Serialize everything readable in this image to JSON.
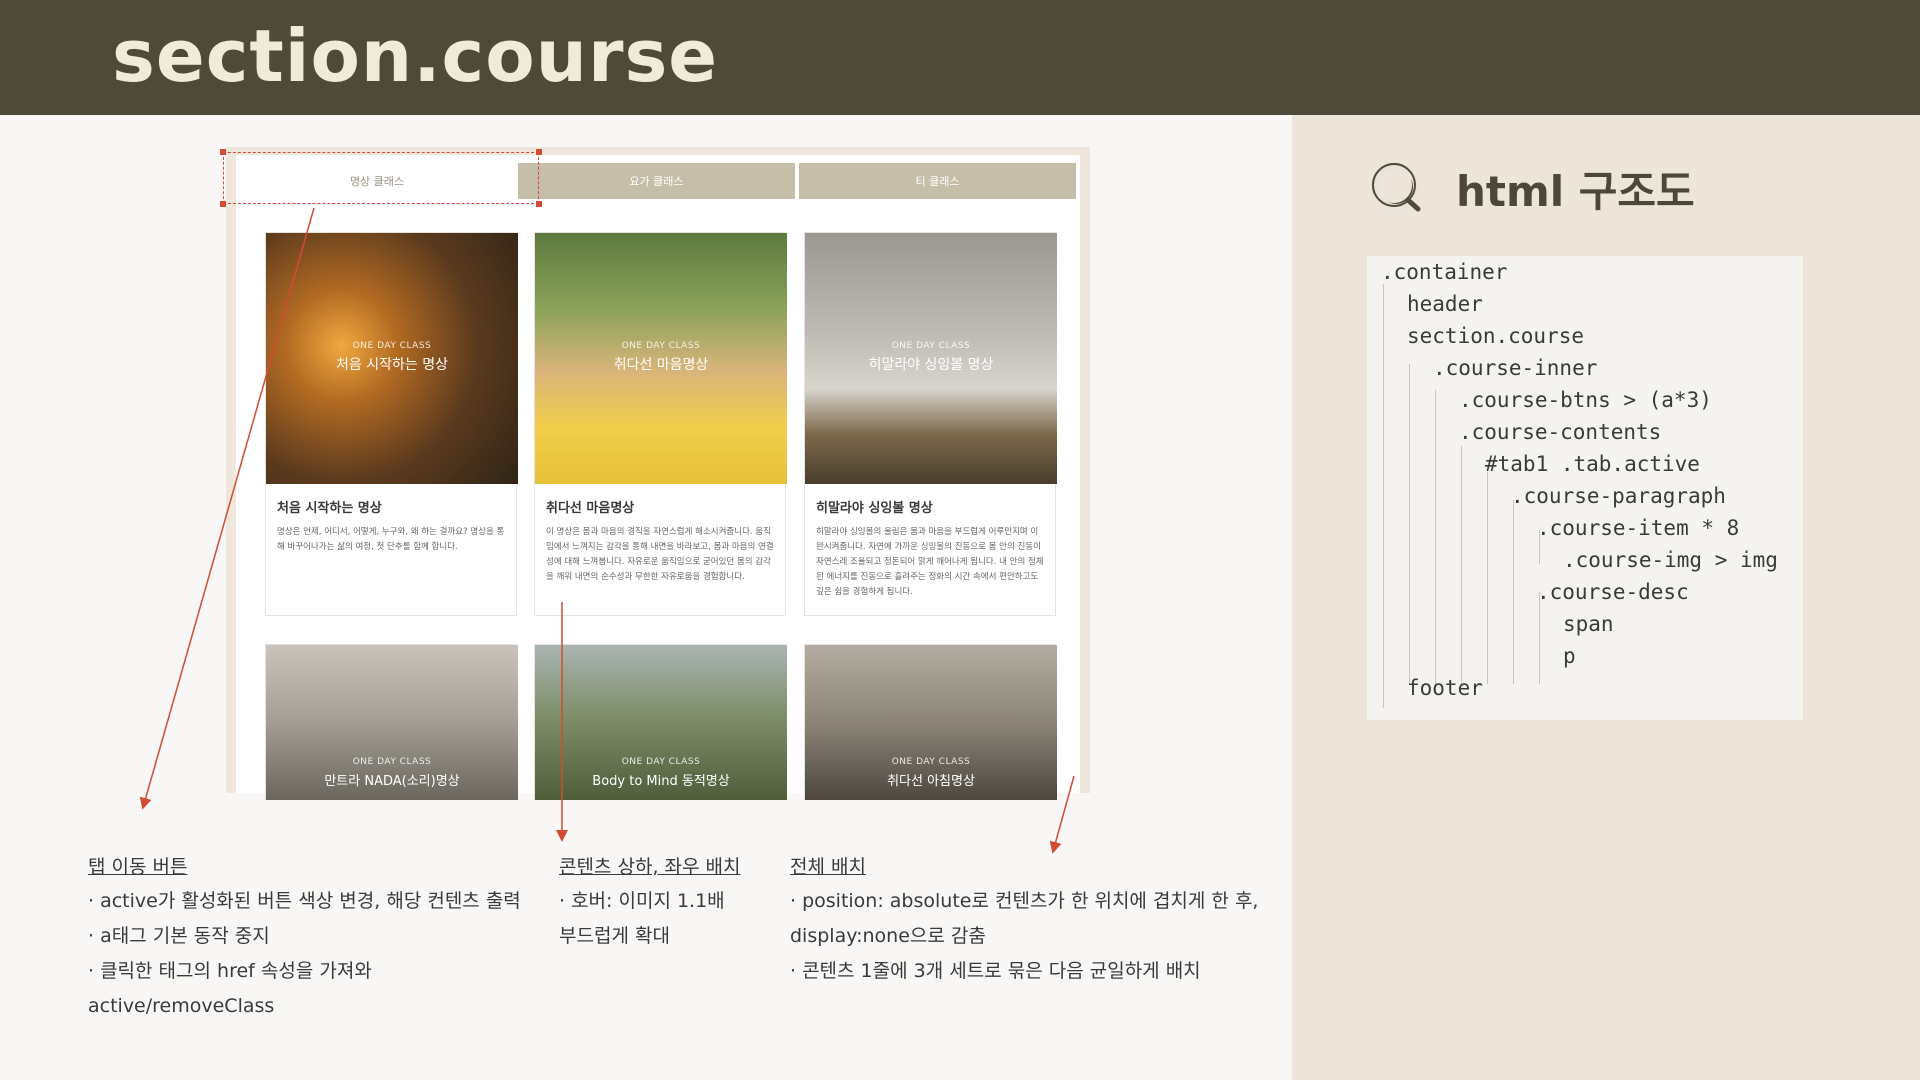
{
  "header": {
    "title": "section.course"
  },
  "side": {
    "title": "html 구조도",
    "tree": [
      ".container",
      "header",
      "section.course",
      ".course-inner",
      ".course-btns > (a*3)",
      ".course-contents",
      "#tab1 .tab.active",
      ".course-paragraph",
      ".course-item * 8",
      ".course-img > img",
      ".course-desc",
      "span",
      "p",
      "footer"
    ]
  },
  "mock": {
    "tabs": [
      "명상 클래스",
      "요가 클래스",
      "티 클래스"
    ],
    "cards": [
      {
        "kicker": "ONE DAY CLASS",
        "overlay": "처음 시작하는 명상",
        "title": "처음 시작하는 명상",
        "desc": "명상은 언제, 어디서, 어떻게, 누구와, 왜 하는 걸까요? 명상을 통해 바꾸어나가는 삶의 여정, 첫 단추를 함께 합니다."
      },
      {
        "kicker": "ONE DAY CLASS",
        "overlay": "취다선 마음명상",
        "title": "취다선 마음명상",
        "desc": "이 명상은 몸과 마음의 경직을 자연스럽게 해소시켜줍니다. 움직임에서 느껴지는 감각을 통해 내면을 바라보고, 몸과 마음의 연결성에 대해 느껴봅니다. 자유로운 움직임으로 굳어있던 몸의 감각을 깨워 내면의 순수성과 무한한 자유로움을 경험합니다."
      },
      {
        "kicker": "ONE DAY CLASS",
        "overlay": "히말라야 싱잉볼 명상",
        "title": "히말라야 싱잉볼 명상",
        "desc": "히말라야 싱잉볼의 울림은 몸과 마음을 부드럽게 어루만지며 이완시켜줍니다. 자연에 가까운 싱잉볼의 진동으로 몸 안의 진동이 자연스레 조율되고 정돈되어 맑게 깨어나게 됩니다. 내 안의 정체된 에너지를 진동으로 흘려주는 정화의 시간 속에서 편안하고도 깊은 쉼을 경험하게 됩니다."
      },
      {
        "kicker": "ONE DAY CLASS",
        "overlay": "만트라 NADA(소리)명상"
      },
      {
        "kicker": "ONE DAY CLASS",
        "overlay": "Body to Mind 동적명상"
      },
      {
        "kicker": "ONE DAY CLASS",
        "overlay": "취다선 아침명상"
      }
    ]
  },
  "notes": {
    "tab": {
      "heading": "탭 이동 버튼",
      "lines": [
        "· active가 활성화된 버튼 색상 변경, 해당 컨텐츠 출력",
        "· a태그 기본 동작 중지",
        "· 클릭한 태그의 href 속성을 가져와",
        "active/removeClass"
      ]
    },
    "content": {
      "heading": "콘텐츠 상하, 좌우 배치",
      "lines": [
        "· 호버: 이미지 1.1배",
        "부드럽게 확대"
      ]
    },
    "layout": {
      "heading": "전체 배치",
      "lines": [
        "· position: absolute로 컨텐츠가 한 위치에 겹치게 한 후,",
        "display:none으로 감춤",
        "· 콘텐츠 1줄에 3개 세트로 묶은 다음 균일하게 배치"
      ]
    }
  },
  "colors": {
    "header_bg": "#4e4a39",
    "header_text": "#f1ead9",
    "side_bg": "#ede5d9",
    "tab_inactive": "#c5bfa9",
    "annotation": "#d24b34"
  }
}
